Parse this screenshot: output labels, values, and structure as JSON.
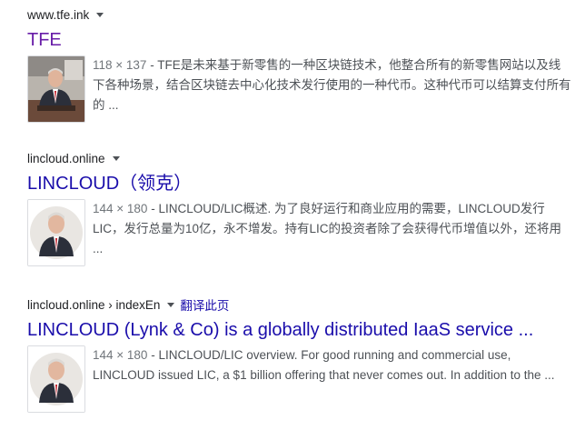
{
  "results": [
    {
      "site": "www.tfe.ink",
      "title": "TFE",
      "dims": "118 × 137",
      "separator": " - ",
      "snippet": "TFE是未来基于新零售的一种区块链技术，他整合所有的新零售网站以及线下各种场景，结合区块链去中心化技术发行使用的一种代币。这种代币可以结算支付所有的 ...",
      "visited": true
    },
    {
      "site": "lincloud.online",
      "title": "LINCLOUD（领克）",
      "dims": "144 × 180",
      "separator": " - ",
      "snippet": "LINCLOUD/LIC概述. 为了良好运行和商业应用的需要，LINCLOUD发行LIC，发行总量为10亿，永不增发。持有LIC的投资者除了会获得代币增值以外，还将用 ...",
      "visited": false
    },
    {
      "site": "lincloud.online › indexEn",
      "translate": "翻译此页",
      "title": "LINCLOUD (Lynk & Co) is a globally distributed IaaS service ...",
      "dims": "144 × 180",
      "separator": " - ",
      "snippet": "LINCLOUD/LIC overview. For good running and commercial use, LINCLOUD issued LIC, a $1 billion offering that never comes out. In addition to the ...",
      "visited": false
    }
  ],
  "colors": {
    "link": "#1a0dab",
    "visited": "#681da8",
    "snippet": "#4d5156",
    "cite": "#202124"
  }
}
